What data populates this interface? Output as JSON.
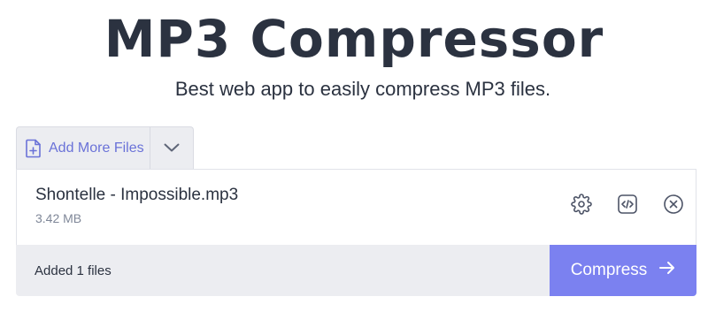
{
  "header": {
    "title": "MP3 Compressor",
    "subtitle": "Best web app to easily compress MP3 files."
  },
  "toolbar": {
    "add_more_label": "Add More Files",
    "add_icon": "file-plus-icon",
    "dropdown_icon": "chevron-down-icon"
  },
  "file": {
    "name": "Shontelle - Impossible.mp3",
    "size": "3.42 MB",
    "actions": [
      "gear-icon",
      "code-icon",
      "close-circle-icon"
    ]
  },
  "footer": {
    "status": "Added 1 files",
    "compress_label": "Compress",
    "compress_icon": "arrow-right-icon"
  },
  "colors": {
    "accent": "#7b81f0",
    "link": "#6a72d8",
    "text": "#2b3240",
    "muted": "#7f8798",
    "panel": "#ecedf1"
  }
}
